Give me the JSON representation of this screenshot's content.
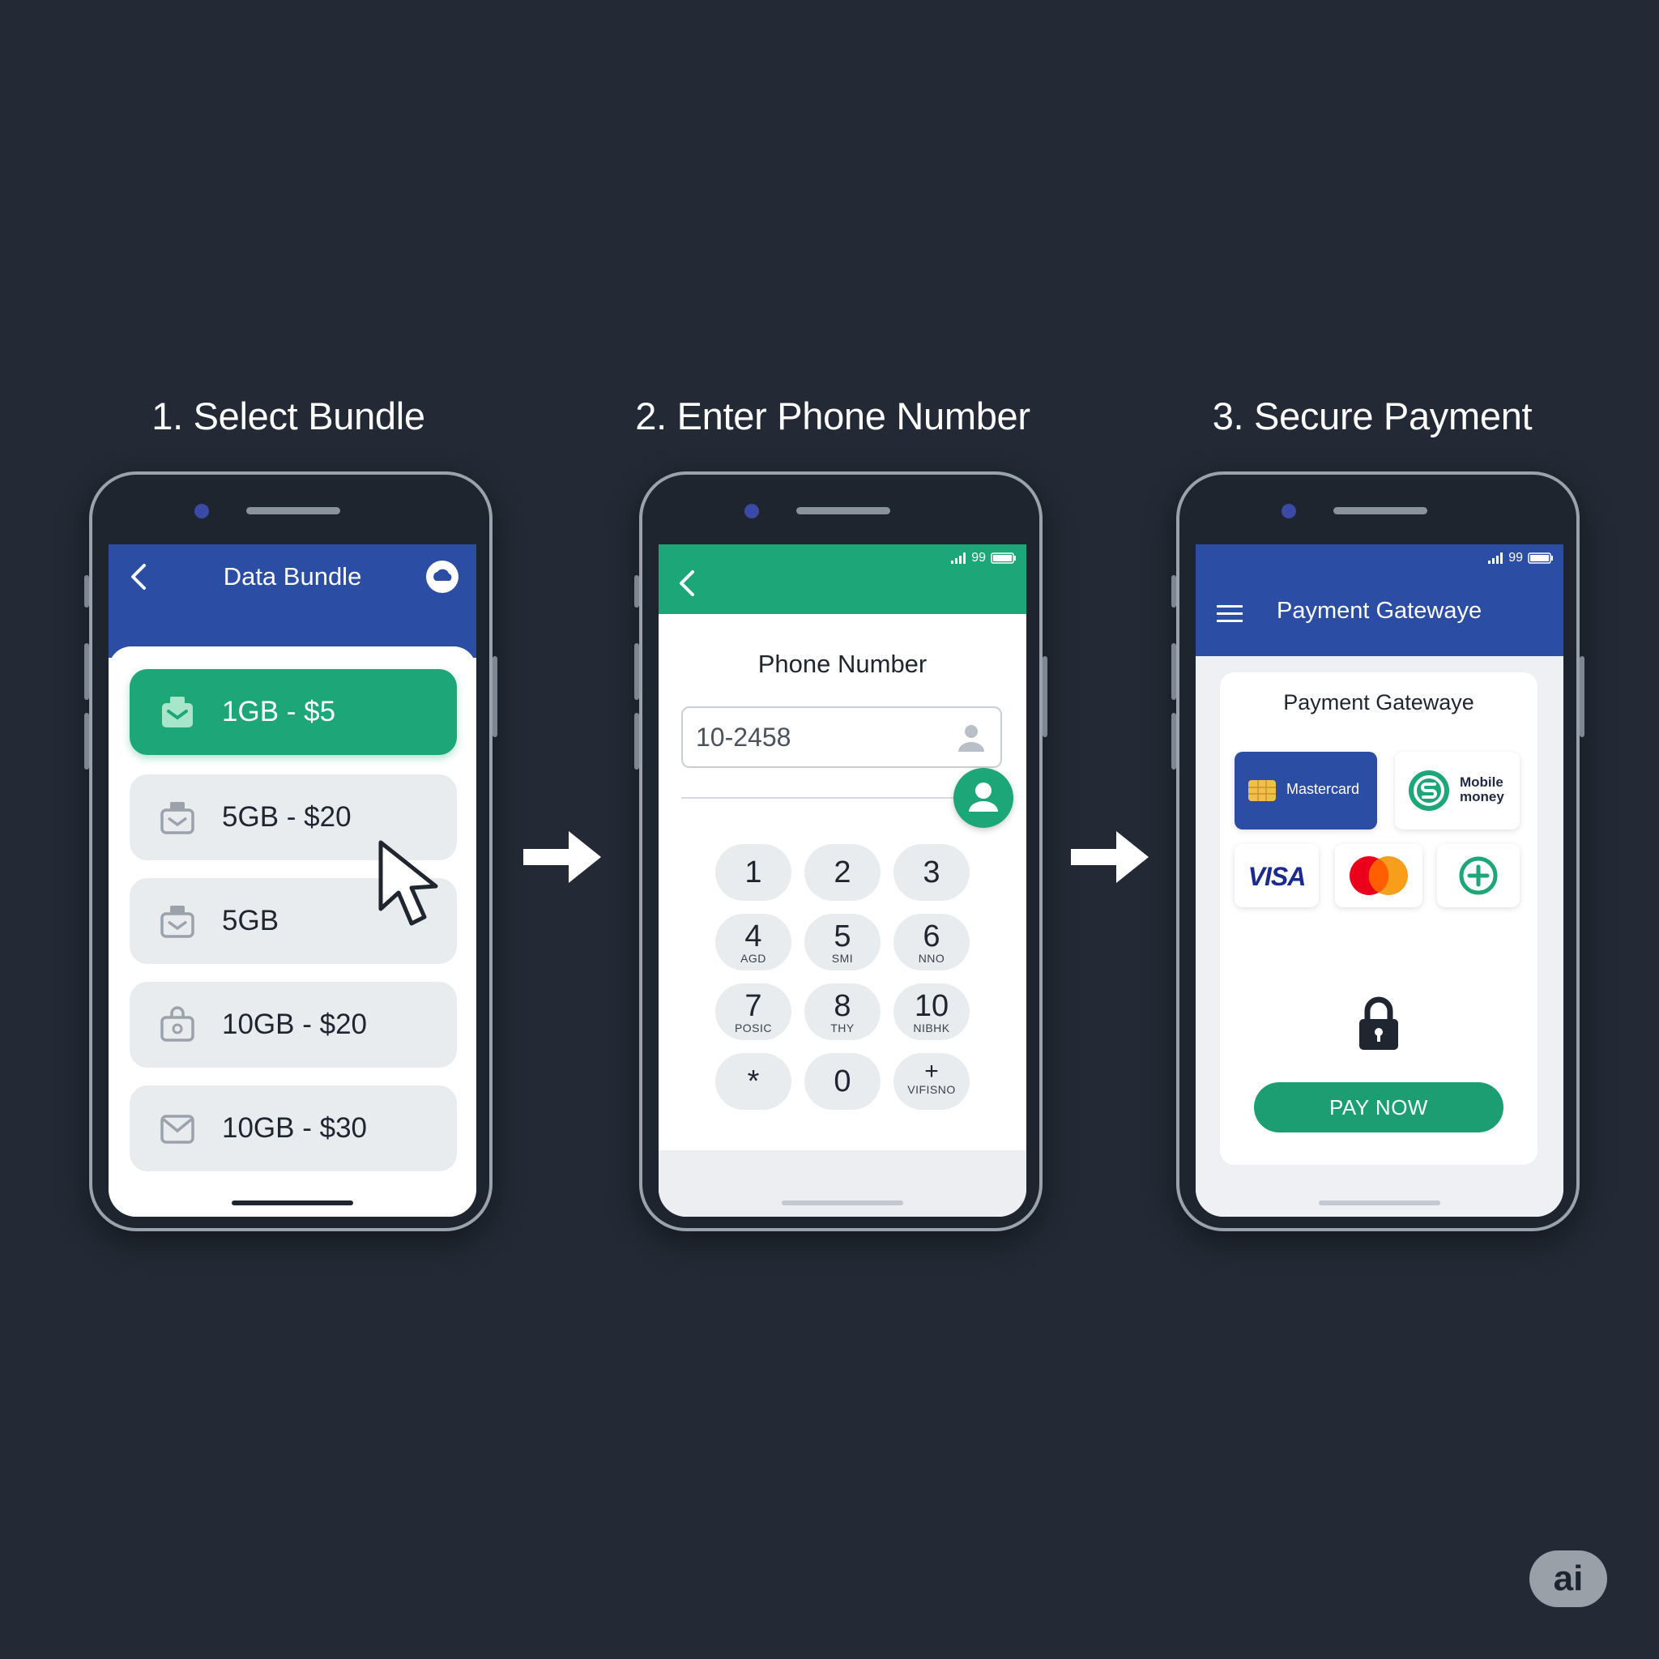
{
  "steps": [
    {
      "title": "1. Select Bundle"
    },
    {
      "title": "2. Enter Phone Number"
    },
    {
      "title": "3. Secure Payment"
    }
  ],
  "bundle_screen": {
    "header_title": "Data Bundle",
    "bundles": [
      {
        "label": "1GB - $5",
        "selected": true
      },
      {
        "label": "5GB - $20",
        "selected": false
      },
      {
        "label": "5GB",
        "selected": false
      },
      {
        "label": "10GB - $20",
        "selected": false
      },
      {
        "label": "10GB - $30",
        "selected": false
      }
    ]
  },
  "phone_screen": {
    "status_text": "99",
    "field_label": "Phone Number",
    "input_value": "10-2458",
    "keypad": [
      {
        "num": "1",
        "sub": ""
      },
      {
        "num": "2",
        "sub": ""
      },
      {
        "num": "3",
        "sub": ""
      },
      {
        "num": "4",
        "sub": "AGD"
      },
      {
        "num": "5",
        "sub": "SMI"
      },
      {
        "num": "6",
        "sub": "NNO"
      },
      {
        "num": "7",
        "sub": "POSIC"
      },
      {
        "num": "8",
        "sub": "THY"
      },
      {
        "num": "10",
        "sub": "NIBHK"
      },
      {
        "num": "*",
        "sub": ""
      },
      {
        "num": "0",
        "sub": ""
      },
      {
        "num": "+",
        "sub": "VIFISNO"
      }
    ]
  },
  "payment_screen": {
    "status_text": "99",
    "header_title": "Payment Gatewaye",
    "card_title": "Payment Gatewaye",
    "methods": {
      "mastercard_label": "Mastercard",
      "mobile_money_line1": "Mobile",
      "mobile_money_line2": "money",
      "visa_label": "VISA"
    },
    "pay_button": "PAY NOW"
  },
  "badge": "ai",
  "colors": {
    "background": "#232a35",
    "blue_header": "#2b4da3",
    "green_accent": "#1da677",
    "bundle_inactive": "#e9ecef",
    "visa_blue": "#1a2a8f",
    "mastercard_red": "#eb001b",
    "mastercard_orange": "#f79e1b"
  },
  "icons": [
    "back-chevron-icon",
    "cloud-icon",
    "bundle-box-icon",
    "mouse-cursor-icon",
    "signal-icon",
    "battery-icon",
    "person-icon",
    "menu-icon",
    "sim-chip-icon",
    "mobile-money-icon",
    "plus-circle-icon",
    "lock-icon",
    "right-arrow-icon"
  ]
}
